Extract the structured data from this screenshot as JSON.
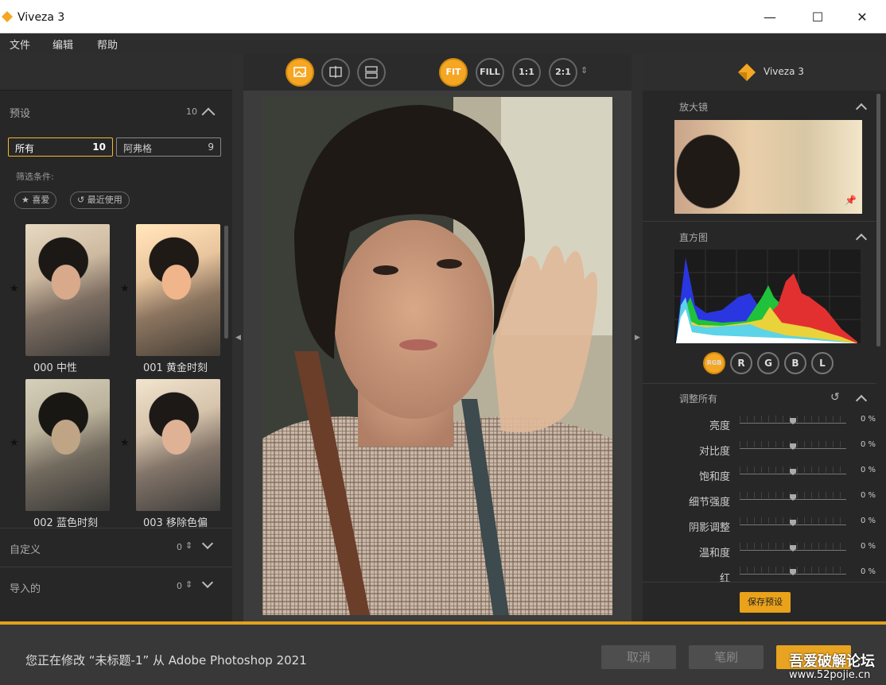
{
  "window": {
    "title": "Viveza 3",
    "minimize": "—",
    "maximize": "☐",
    "close": "✕"
  },
  "menu": [
    "文件",
    "编辑",
    "帮助"
  ],
  "left": {
    "presets_title": "预设",
    "presets_count": "10",
    "tabs": [
      {
        "label": "所有",
        "count": "10"
      },
      {
        "label": "阿弗格",
        "count": "9"
      }
    ],
    "filter_label": "筛选条件:",
    "chips": [
      {
        "icon": "star-icon",
        "label": "喜爱"
      },
      {
        "icon": "recent-icon",
        "label": "最近使用"
      }
    ],
    "thumbnails": [
      {
        "label": "000 中性"
      },
      {
        "label": "001 黄金时刻"
      },
      {
        "label": "002 蓝色时刻"
      },
      {
        "label": "003 移除色偏"
      }
    ],
    "custom_title": "自定义",
    "custom_count": "0",
    "imported_title": "导入的",
    "imported_count": "0"
  },
  "center": {
    "zoom_buttons": [
      "FIT",
      "FILL",
      "1:1",
      "2:1"
    ],
    "active_zoom": "FIT"
  },
  "right": {
    "brand": "Viveza 3",
    "loupe_title": "放大镜",
    "histogram_title": "直方图",
    "histogram_buttons": [
      "RGB",
      "R",
      "G",
      "B",
      "L"
    ],
    "adjust_title": "调整所有",
    "adjustments": [
      {
        "label": "亮度",
        "value": "0 %"
      },
      {
        "label": "对比度",
        "value": "0 %"
      },
      {
        "label": "饱和度",
        "value": "0 %"
      },
      {
        "label": "细节强度",
        "value": "0 %"
      },
      {
        "label": "阴影调整",
        "value": "0 %"
      },
      {
        "label": "温和度",
        "value": "0 %"
      },
      {
        "label": "红",
        "value": "0 %"
      }
    ],
    "save_preset": "保存预设"
  },
  "bottom": {
    "status": "您正在修改 “未标题-1” 从 Adobe Photoshop 2021",
    "cancel": "取消",
    "brush": "笔刷",
    "watermark": "吾爱破解论坛",
    "watermark_url": "www.52pojie.cn"
  },
  "colors": {
    "accent": "#f5a623",
    "panel": "#272727",
    "bottom_accent": "#e2a11d"
  }
}
